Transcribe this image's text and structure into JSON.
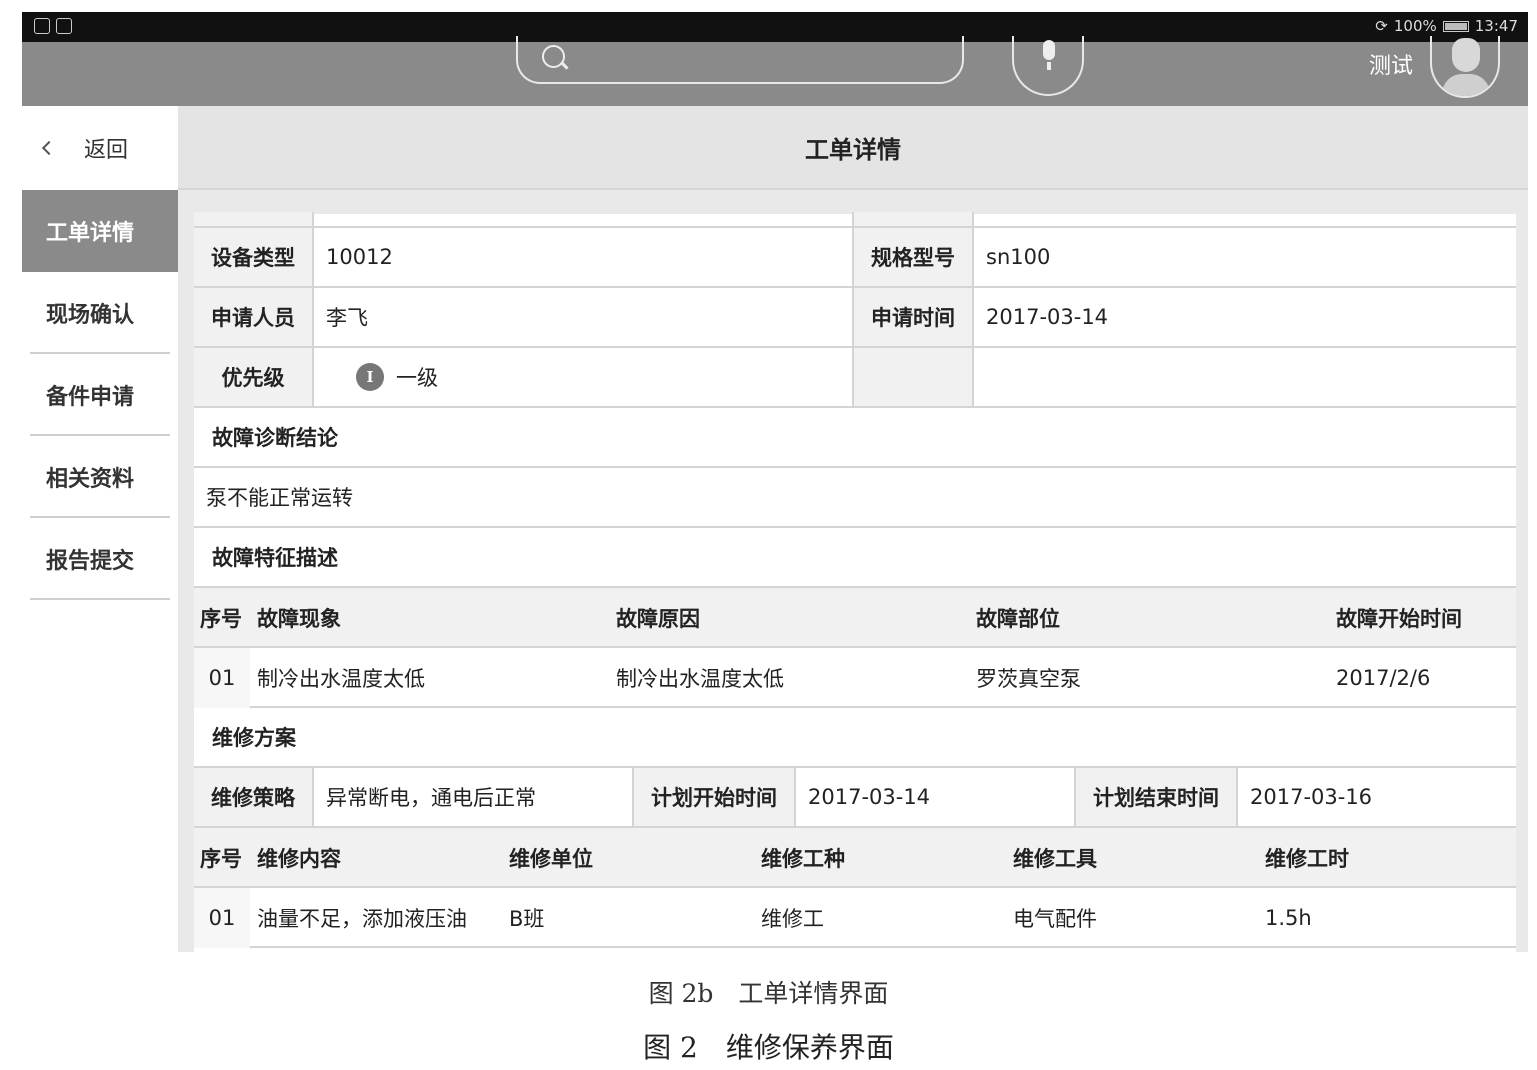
{
  "status_bar": {
    "battery": "100%",
    "time": "13:47"
  },
  "header": {
    "search": {
      "placeholder": ""
    },
    "username": "测试"
  },
  "sidebar": {
    "back_label": "返回",
    "items": [
      {
        "label": "工单详情",
        "active": true
      },
      {
        "label": "现场确认",
        "active": false
      },
      {
        "label": "备件申请",
        "active": false
      },
      {
        "label": "相关资料",
        "active": false
      },
      {
        "label": "报告提交",
        "active": false
      }
    ]
  },
  "main": {
    "title": "工单详情",
    "info": {
      "device_type_label": "设备类型",
      "device_type_value": "10012",
      "spec_label": "规格型号",
      "spec_value": "sn100",
      "applicant_label": "申请人员",
      "applicant_value": "李飞",
      "apply_time_label": "申请时间",
      "apply_time_value": "2017-03-14",
      "priority_label": "优先级",
      "priority_icon_text": "I",
      "priority_value": "一级"
    },
    "diagnosis": {
      "title": "故障诊断结论",
      "text": "泵不能正常运转"
    },
    "fault": {
      "title": "故障特征描述",
      "columns": [
        "序号",
        "故障现象",
        "故障原因",
        "故障部位",
        "故障开始时间"
      ],
      "rows": [
        [
          "01",
          "制冷出水温度太低",
          "制冷出水温度太低",
          "罗茨真空泵",
          "2017/2/6"
        ]
      ]
    },
    "plan": {
      "title": "维修方案",
      "strategy_label": "维修策略",
      "strategy_value": "异常断电，通电后正常",
      "start_label": "计划开始时间",
      "start_value": "2017-03-14",
      "end_label": "计划结束时间",
      "end_value": "2017-03-16",
      "columns": [
        "序号",
        "维修内容",
        "维修单位",
        "维修工种",
        "维修工具",
        "维修工时"
      ],
      "rows": [
        [
          "01",
          "油量不足，添加液压油",
          "B班",
          "维修工",
          "电气配件",
          "1.5h"
        ]
      ]
    }
  },
  "captions": {
    "sub": "图 2b　工单详情界面",
    "main": "图 2　维修保养界面"
  }
}
